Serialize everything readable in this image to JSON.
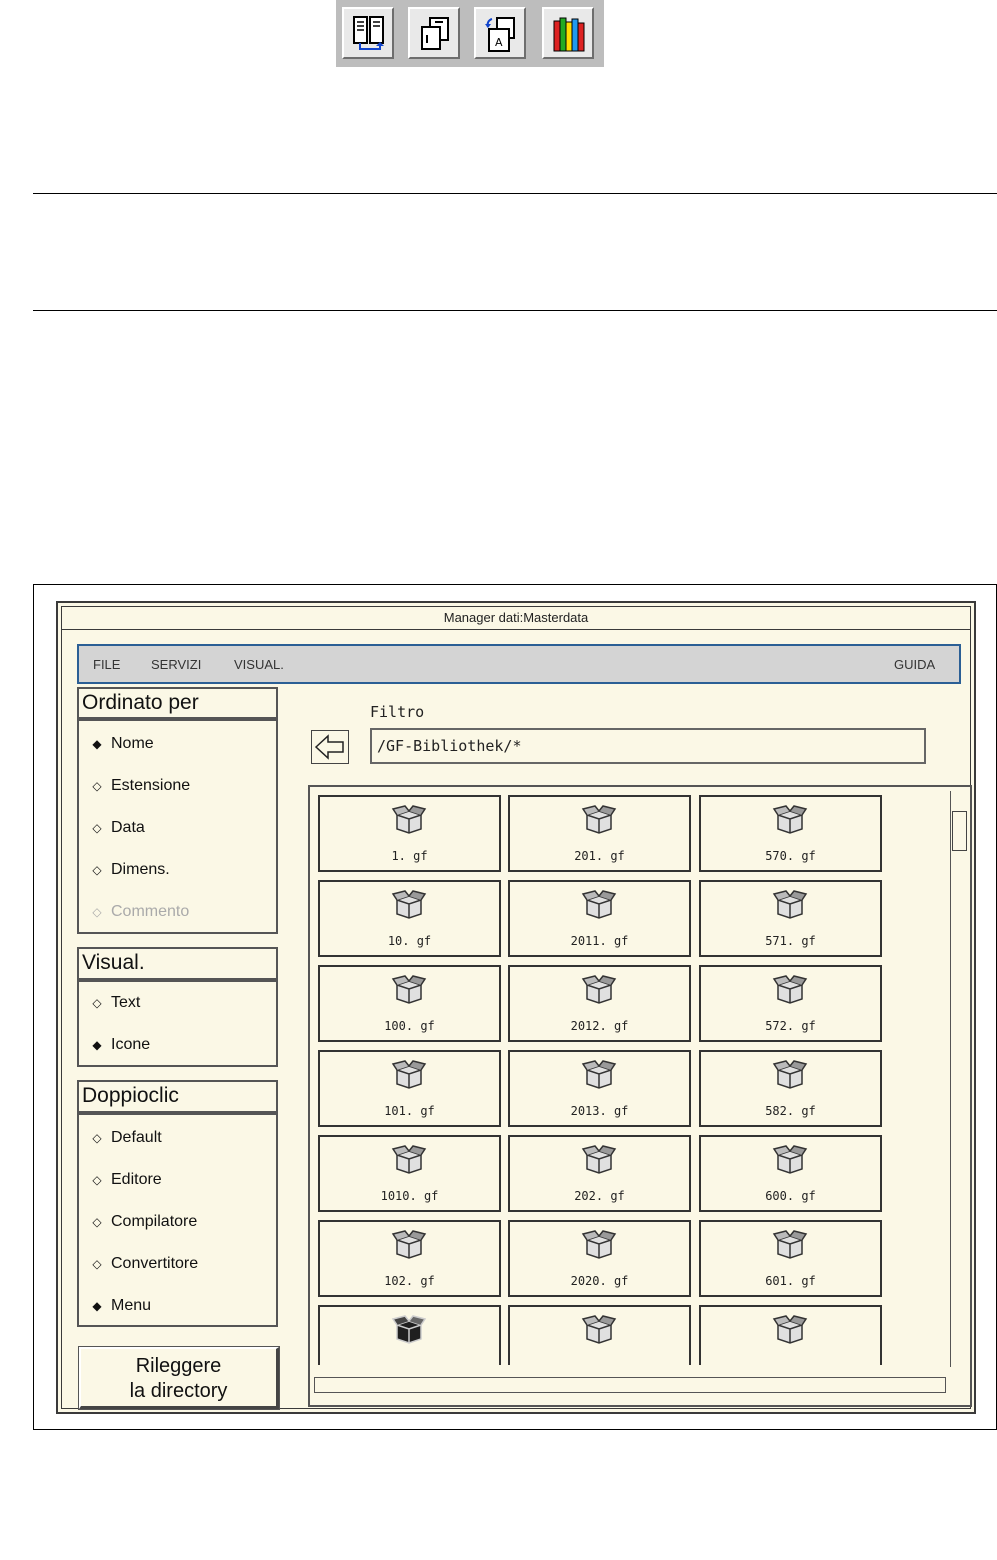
{
  "toolbar": {
    "buttons": [
      {
        "icon": "split-view-icon"
      },
      {
        "icon": "copy-pages-icon"
      },
      {
        "icon": "convert-document-icon"
      },
      {
        "icon": "library-books-icon"
      }
    ]
  },
  "window": {
    "title": "Manager dati:Masterdata",
    "menu": {
      "file": "FILE",
      "services": "SERVIZI",
      "view": "VISUAL.",
      "help": "GUIDA"
    }
  },
  "sort": {
    "title": "Ordinato per",
    "options": [
      {
        "label": "Nome",
        "selected": true
      },
      {
        "label": "Estensione",
        "selected": false
      },
      {
        "label": "Data",
        "selected": false
      },
      {
        "label": "Dimens.",
        "selected": false
      },
      {
        "label": "Commento",
        "selected": false,
        "disabled": true
      }
    ]
  },
  "view": {
    "title": "Visual.",
    "options": [
      {
        "label": "Text",
        "selected": false
      },
      {
        "label": "Icone",
        "selected": true
      }
    ]
  },
  "doubleclick": {
    "title": "Doppioclic",
    "options": [
      {
        "label": "Default",
        "selected": false
      },
      {
        "label": "Editore",
        "selected": false
      },
      {
        "label": "Compilatore",
        "selected": false
      },
      {
        "label": "Convertitore",
        "selected": false
      },
      {
        "label": "Menu",
        "selected": true
      }
    ]
  },
  "reload_button": {
    "line1": "Rileggere",
    "line2": "la directory"
  },
  "filter": {
    "label": "Filtro",
    "value": "/GF-Bibliothek/*"
  },
  "files": [
    [
      "1. gf",
      "201. gf",
      "570. gf"
    ],
    [
      "10. gf",
      "2011. gf",
      "571. gf"
    ],
    [
      "100. gf",
      "2012. gf",
      "572. gf"
    ],
    [
      "101. gf",
      "2013. gf",
      "582. gf"
    ],
    [
      "1010. gf",
      "202. gf",
      "600. gf"
    ],
    [
      "102. gf",
      "2020. gf",
      "601. gf"
    ]
  ]
}
